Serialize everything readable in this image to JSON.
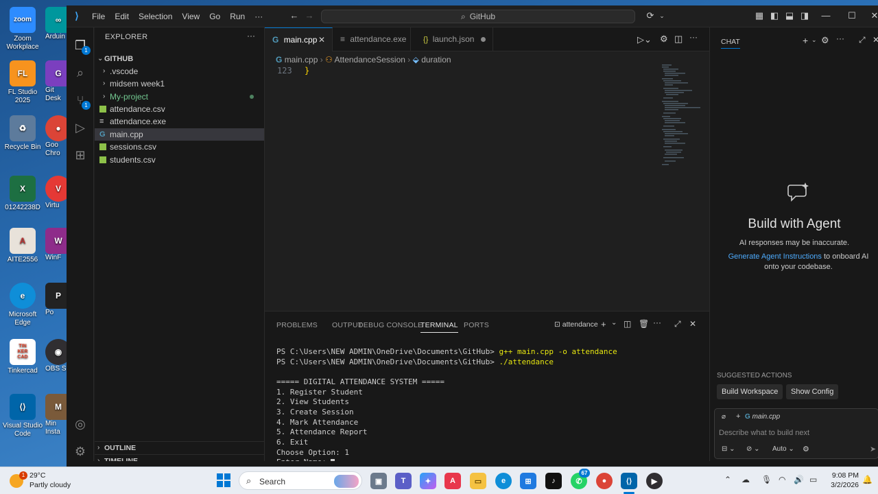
{
  "desktop": {
    "icons": [
      {
        "label": "Zoom\nWorkplace",
        "badge": "zoom"
      },
      {
        "label": "Arduin",
        "badge": "∞"
      },
      {
        "label": "FL Studio\n2025",
        "badge": "FL"
      },
      {
        "label": "Git\nDesk",
        "badge": "G"
      },
      {
        "label": "Recycle Bin",
        "badge": "♻"
      },
      {
        "label": "Goo\nChro",
        "badge": "●"
      },
      {
        "label": "01242238D",
        "badge": "X"
      },
      {
        "label": "Virtu",
        "badge": "V"
      },
      {
        "label": "AITE2556",
        "badge": "A"
      },
      {
        "label": "WinF",
        "badge": "W"
      },
      {
        "label": "Microsoft\nEdge",
        "badge": "e"
      },
      {
        "label": "Po",
        "badge": "P"
      },
      {
        "label": "Tinkercad",
        "badge": "TIN\nKER\nCAD"
      },
      {
        "label": "OBS S",
        "badge": "◉"
      },
      {
        "label": "Visual Studio\nCode",
        "badge": "⟨⟩"
      },
      {
        "label": "Min\nInsta",
        "badge": "M"
      }
    ]
  },
  "titlebar": {
    "menus": [
      "File",
      "Edit",
      "Selection",
      "View",
      "Go",
      "Run",
      "···"
    ],
    "search": "GitHub"
  },
  "activity": {
    "explorer_badge": "1",
    "scm_badge": "1"
  },
  "explorer": {
    "title": "EXPLORER",
    "root": "GITHUB",
    "items": [
      {
        "label": ".vscode",
        "kind": "folder"
      },
      {
        "label": "midsem week1",
        "kind": "folder"
      },
      {
        "label": "My-project",
        "kind": "folder"
      },
      {
        "label": "attendance.csv",
        "kind": "csv"
      },
      {
        "label": "attendance.exe",
        "kind": "exe"
      },
      {
        "label": "main.cpp",
        "kind": "cpp"
      },
      {
        "label": "sessions.csv",
        "kind": "csv"
      },
      {
        "label": "students.csv",
        "kind": "csv"
      }
    ],
    "outline": "OUTLINE",
    "timeline": "TIMELINE"
  },
  "editor": {
    "tabs": [
      {
        "label": "main.cpp",
        "icon": "G"
      },
      {
        "label": "attendance.exe",
        "icon": "≡"
      },
      {
        "label": "launch.json",
        "icon": "{}"
      }
    ],
    "breadcrumb": {
      "file": "main.cpp",
      "symbol": "AttendanceSession",
      "member": "duration"
    },
    "line_number": "123",
    "line_text": "}"
  },
  "panel": {
    "tabs": [
      "PROBLEMS",
      "OUTPUT",
      "DEBUG CONSOLE",
      "TERMINAL",
      "PORTS"
    ],
    "terminal_name": "attendance",
    "lines": [
      {
        "prompt": "PS C:\\Users\\NEW ADMIN\\OneDrive\\Documents\\GitHub> ",
        "cmd": "g++ main.cpp -o attendance"
      },
      {
        "prompt": "PS C:\\Users\\NEW ADMIN\\OneDrive\\Documents\\GitHub> ",
        "cmd": "./attendance"
      },
      {
        "text": ""
      },
      {
        "text": "===== DIGITAL ATTENDANCE SYSTEM ====="
      },
      {
        "text": "1. Register Student"
      },
      {
        "text": "2. View Students"
      },
      {
        "text": "3. Create Session"
      },
      {
        "text": "4. Mark Attendance"
      },
      {
        "text": "5. Attendance Report"
      },
      {
        "text": "6. Exit"
      },
      {
        "text": "Choose Option: 1"
      },
      {
        "text": "Enter Name: "
      }
    ]
  },
  "chat": {
    "title": "CHAT",
    "heading": "Build with Agent",
    "disclaimer": "AI responses may be inaccurate.",
    "link": "Generate Agent Instructions",
    "after_link": " to onboard AI onto your codebase.",
    "suggested_title": "SUGGESTED ACTIONS",
    "suggested": [
      "Build Workspace",
      "Show Config"
    ],
    "context_file": "main.cpp",
    "input_placeholder": "Describe what to build next",
    "mode": "Auto"
  },
  "taskbar": {
    "weather_temp": "29°C",
    "weather_desc": "Partly cloudy",
    "weather_badge": "1",
    "search": "Search",
    "whatsapp_badge": "67",
    "time": "9:08 PM",
    "date": "3/2/2026"
  },
  "colors": {
    "accent": "#0078d4",
    "link": "#4daafc",
    "folder_modified": "#73c991",
    "csv": "#8dc149"
  }
}
